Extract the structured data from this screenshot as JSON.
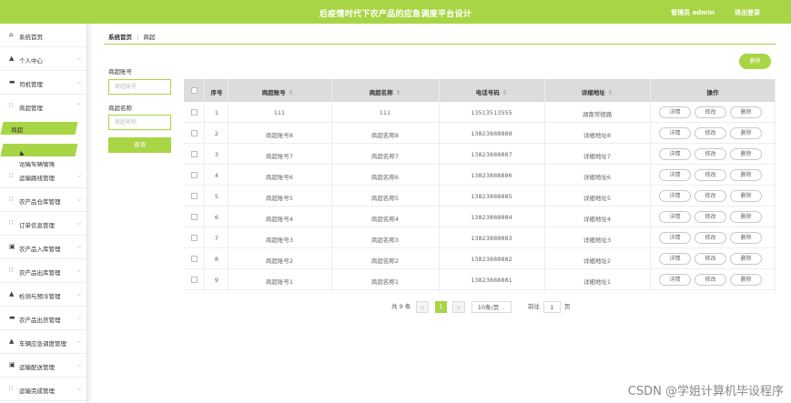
{
  "header": {
    "title": "后疫情时代下农产品的应急调度平台设计",
    "admin_label": "管理员 admin",
    "logout_label": "退出登录",
    "accent_color": "#a8d545"
  },
  "sidebar": {
    "items": [
      {
        "label": "系统首页",
        "icon": "home-icon"
      },
      {
        "label": "个人中心",
        "icon": "user-icon"
      },
      {
        "label": "司机管理",
        "icon": "driver-icon"
      },
      {
        "label": "商超管理",
        "icon": "grid-icon"
      },
      {
        "label": "运输车辆管理",
        "icon": "user-icon"
      },
      {
        "label": "运输路线管理",
        "icon": "grid-icon"
      },
      {
        "label": "农产品仓库管理",
        "icon": "grid-icon"
      },
      {
        "label": "订单信息管理",
        "icon": "grid-icon"
      },
      {
        "label": "农产品入库管理",
        "icon": "doc-icon"
      },
      {
        "label": "农产品出库管理",
        "icon": "grid-icon"
      },
      {
        "label": "检测与预冷管理",
        "icon": "user-icon"
      },
      {
        "label": "农产品出货管理",
        "icon": "truck-icon"
      },
      {
        "label": "车辆应急调度管理",
        "icon": "user-icon"
      },
      {
        "label": "运输配送管理",
        "icon": "doc-icon"
      },
      {
        "label": "运输完成管理",
        "icon": "grid-icon"
      }
    ],
    "sub_item": "商超"
  },
  "breadcrumb": {
    "home": "系统首页",
    "current": "商超"
  },
  "toolbar": {
    "delete_label": "删除"
  },
  "search": {
    "account_label": "商超账号",
    "account_placeholder": "商超账号",
    "name_label": "商超名称",
    "name_placeholder": "商超名称",
    "search_label": "查询"
  },
  "table": {
    "headers": {
      "index": "序号",
      "account": "商超账号",
      "name": "商超名称",
      "phone": "电话号码",
      "address": "详细地址",
      "ops": "操作"
    },
    "ops": {
      "detail": "详情",
      "edit": "修改",
      "delete": "删除"
    },
    "rows": [
      {
        "index": "1",
        "account": "111",
        "name": "111",
        "phone": "13513513555",
        "address": "湖南常德路"
      },
      {
        "index": "2",
        "account": "商超账号8",
        "name": "商超名称8",
        "phone": "13823888888",
        "address": "详细地址8"
      },
      {
        "index": "3",
        "account": "商超账号7",
        "name": "商超名称7",
        "phone": "13823888887",
        "address": "详细地址7"
      },
      {
        "index": "4",
        "account": "商超账号6",
        "name": "商超名称6",
        "phone": "13823888886",
        "address": "详细地址6"
      },
      {
        "index": "5",
        "account": "商超账号5",
        "name": "商超名称5",
        "phone": "13823888885",
        "address": "详细地址5"
      },
      {
        "index": "6",
        "account": "商超账号4",
        "name": "商超名称4",
        "phone": "13823888884",
        "address": "详细地址4"
      },
      {
        "index": "7",
        "account": "商超账号3",
        "name": "商超名称3",
        "phone": "13823888883",
        "address": "详细地址3"
      },
      {
        "index": "8",
        "account": "商超账号2",
        "name": "商超名称2",
        "phone": "13823888882",
        "address": "详细地址2"
      },
      {
        "index": "9",
        "account": "商超账号1",
        "name": "商超名称1",
        "phone": "13823888881",
        "address": "详细地址1"
      }
    ]
  },
  "pager": {
    "total": "共 9 条",
    "prev": "<",
    "current": "1",
    "next": ">",
    "page_size": "10条/页",
    "goto_label": "前往",
    "goto_value": "1",
    "page_unit": "页"
  },
  "watermark": "CSDN @学姐计算机毕设程序"
}
